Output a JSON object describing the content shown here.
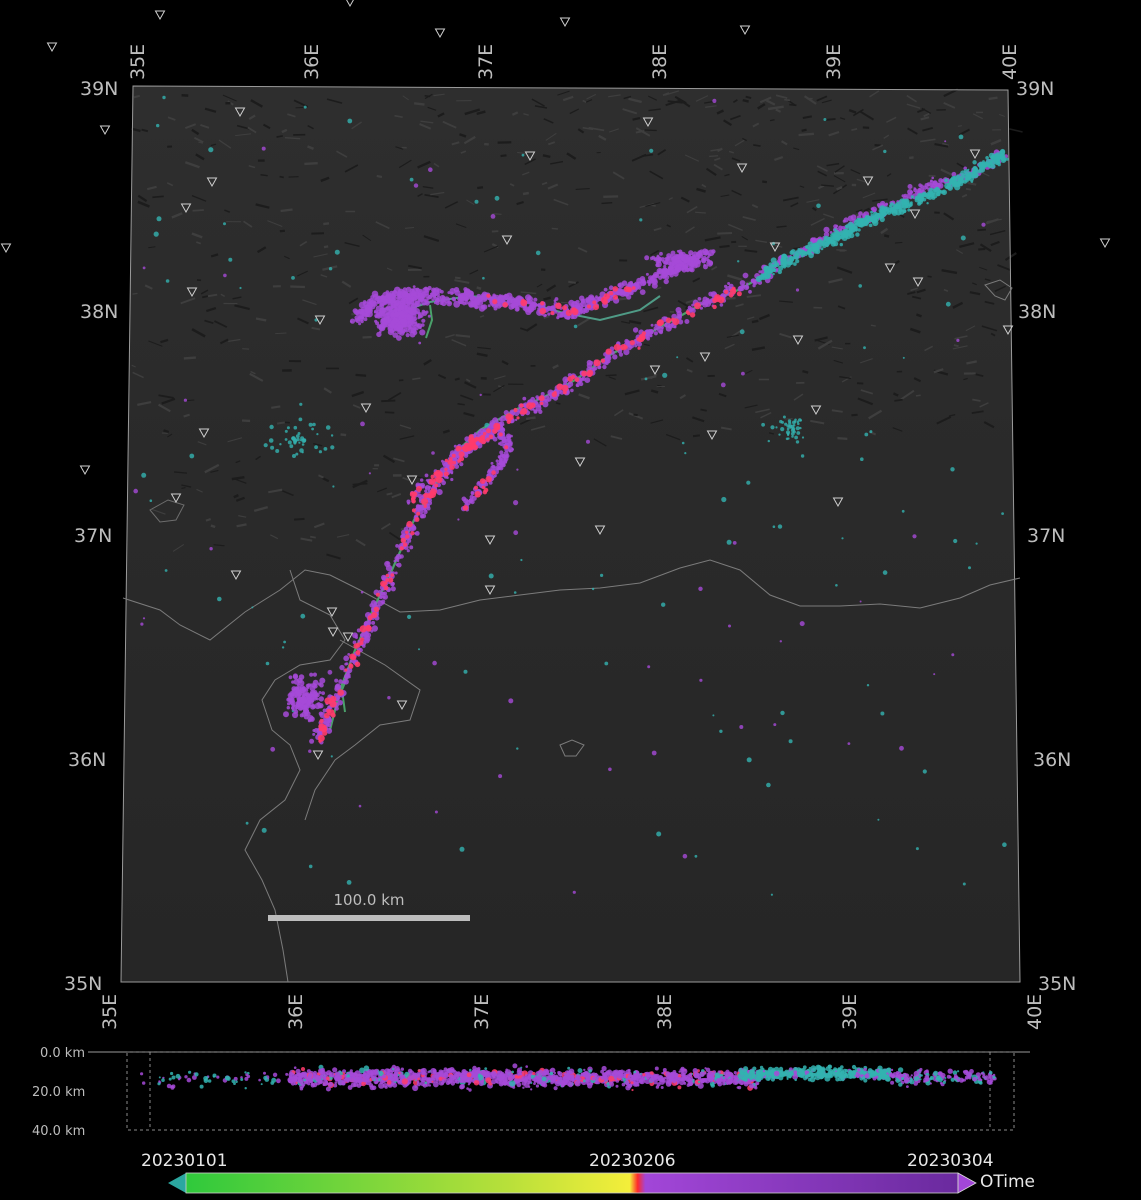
{
  "map": {
    "lon_labels": [
      "35E",
      "36E",
      "37E",
      "38E",
      "39E",
      "40E"
    ],
    "lat_labels": [
      "39N",
      "38N",
      "37N",
      "36N",
      "35N"
    ],
    "scale_bar_label": "100.0 km",
    "colors": {
      "background": "#000000",
      "terrain": "#2b2b2b",
      "fault_trace": "#4aa06a",
      "early_events": "#33b3b0",
      "mainshock_day": "#ff3b6b",
      "aftershocks": "#a64ad8",
      "station_marker": "#cfcfcf"
    },
    "icons": {
      "station": "inverted-triangle-icon"
    }
  },
  "depth_section": {
    "labels": [
      "0.0 km",
      "20.0 km",
      "40.0 km"
    ]
  },
  "colorbar": {
    "start_label": "20230101",
    "mid_label": "20230206",
    "end_label": "20230304",
    "title": "OTime",
    "colors": [
      "#2fc93c",
      "#e6ec3a",
      "#ff2a2a",
      "#a246d8",
      "#6a2a9e"
    ]
  }
}
